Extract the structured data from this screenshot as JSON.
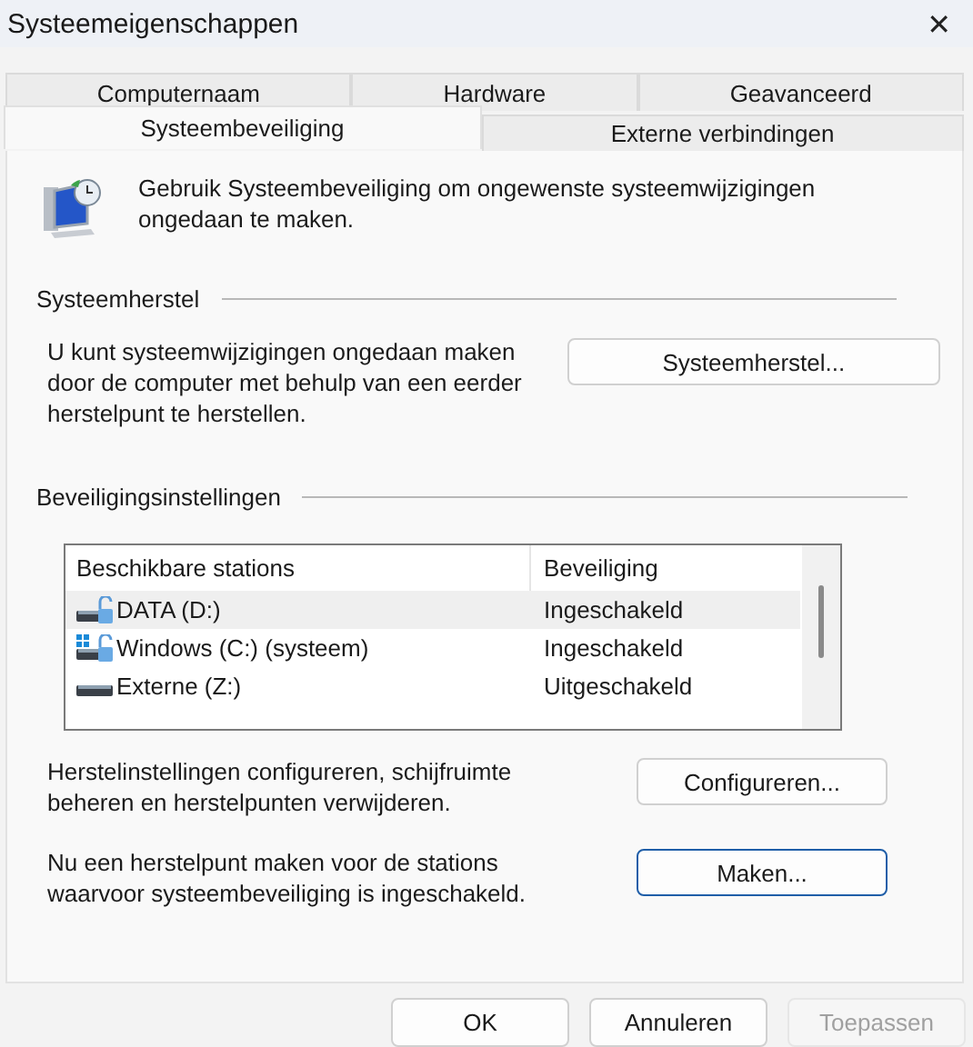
{
  "window": {
    "title": "Systeemeigenschappen",
    "close": "✕"
  },
  "tab_rows": [
    [
      {
        "label": "Computernaam",
        "selected": false
      },
      {
        "label": "Hardware",
        "selected": false
      },
      {
        "label": "Geavanceerd",
        "selected": false
      }
    ],
    [
      {
        "label": "Systeembeveiliging",
        "selected": true
      },
      {
        "label": "Externe verbindingen",
        "selected": false
      }
    ]
  ],
  "intro": "Gebruik Systeembeveiliging om ongewenste systeemwijzigingen ongedaan te maken.",
  "restore": {
    "heading": "Systeemherstel",
    "text": "U kunt systeemwijzigingen ongedaan maken door de computer met behulp van een eerder herstelpunt te herstellen.",
    "button": "Systeemherstel..."
  },
  "protection": {
    "heading": "Beveiligingsinstellingen",
    "columns": [
      "Beschikbare stations",
      "Beveiliging"
    ],
    "rows": [
      {
        "kind": "protected",
        "name": "DATA (D:)",
        "status": "Ingeschakeld",
        "selected": true
      },
      {
        "kind": "system",
        "name": "Windows (C:) (systeem)",
        "status": "Ingeschakeld",
        "selected": false
      },
      {
        "kind": "plain",
        "name": "Externe (Z:)",
        "status": "Uitgeschakeld",
        "selected": false
      }
    ],
    "actions": [
      {
        "text": "Herstelinstellingen configureren, schijfruimte beheren en herstelpunten verwijderen.",
        "button": "Configureren...",
        "focused": false
      },
      {
        "text": "Nu een herstelpunt maken voor de stations waarvoor systeembeveiliging is ingeschakeld.",
        "button": "Maken...",
        "focused": true
      }
    ]
  },
  "buttons": [
    {
      "label": "OK",
      "disabled": false
    },
    {
      "label": "Annuleren",
      "disabled": false
    },
    {
      "label": "Toepassen",
      "disabled": true
    }
  ]
}
